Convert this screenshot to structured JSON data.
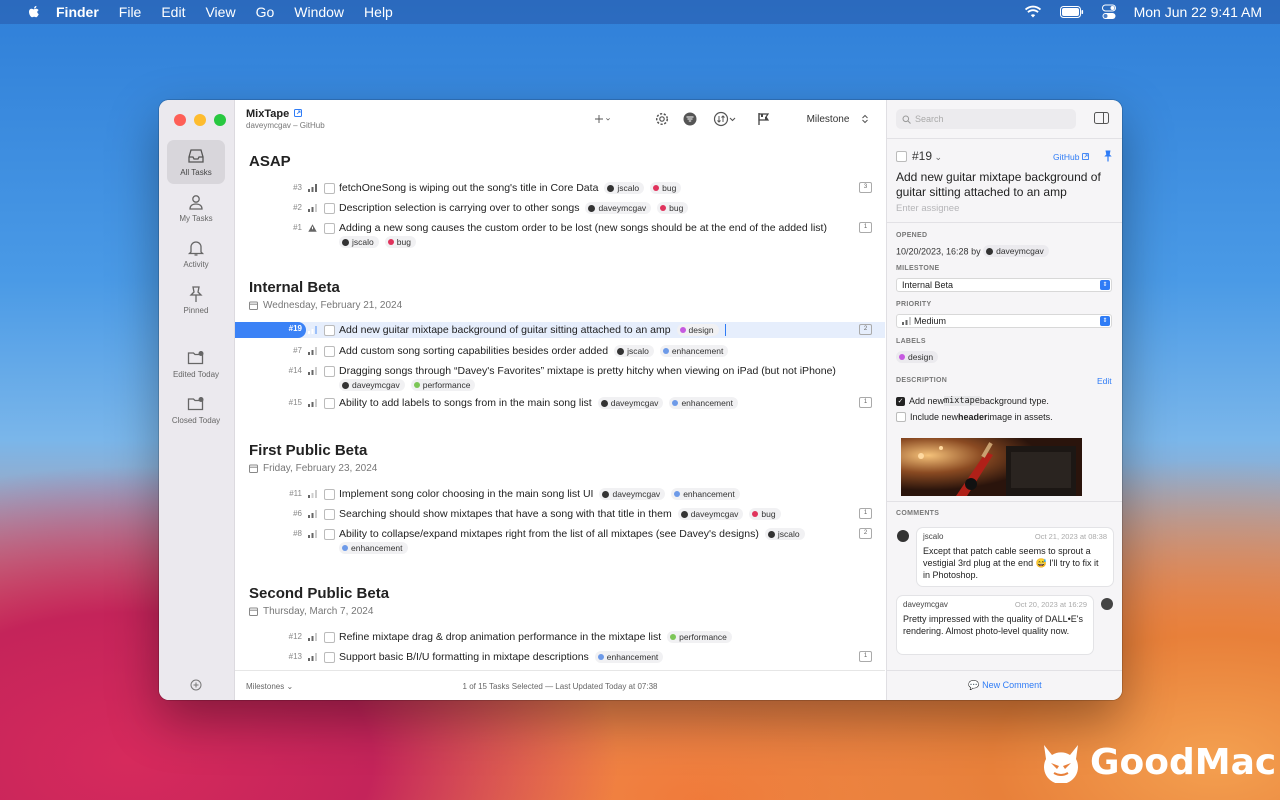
{
  "menubar": {
    "app": "Finder",
    "items": [
      "File",
      "Edit",
      "View",
      "Go",
      "Window",
      "Help"
    ],
    "clock": "Mon Jun 22  9:41 AM"
  },
  "sidebar": {
    "items": [
      {
        "label": "All Tasks",
        "icon": "tray-icon"
      },
      {
        "label": "My Tasks",
        "icon": "person-icon"
      },
      {
        "label": "Activity",
        "icon": "bell-icon"
      },
      {
        "label": "Pinned",
        "icon": "pin-icon"
      },
      {
        "label": "Edited Today",
        "icon": "folder-badge-icon"
      },
      {
        "label": "Closed Today",
        "icon": "folder-badge-icon"
      }
    ]
  },
  "toolbar": {
    "title": "MixTape",
    "subtitle": "daveymcgav – GitHub",
    "milestone_label": "Milestone"
  },
  "sections": [
    {
      "title": "ASAP",
      "date": ""
    },
    {
      "title": "Internal Beta",
      "date": "Wednesday, February 21, 2024"
    },
    {
      "title": "First Public Beta",
      "date": "Friday, February 23, 2024"
    },
    {
      "title": "Second Public Beta",
      "date": "Thursday, March 7, 2024"
    }
  ],
  "tasks": [
    {
      "num": "#3",
      "text": "fetchOneSong is wiping out the song's title in Core Data",
      "user": "jscalo",
      "tag": "bug",
      "comments": "3"
    },
    {
      "num": "#2",
      "text": "Description selection is carrying over to other songs",
      "user": "daveymcgav",
      "tag": "bug",
      "comments": ""
    },
    {
      "num": "#1",
      "text": "Adding a new song causes the custom order to be lost (new songs should be at the end of the added list)",
      "user": "jscalo",
      "tag": "bug",
      "comments": "1"
    },
    {
      "num": "#19",
      "text": "Add new guitar mixtape background of guitar sitting attached to an amp",
      "user": "",
      "tag": "design",
      "comments": "2"
    },
    {
      "num": "#7",
      "text": "Add custom song sorting capabilities besides order added",
      "user": "jscalo",
      "tag": "enhancement",
      "comments": ""
    },
    {
      "num": "#14",
      "text": "Dragging songs through “Davey's Favorites” mixtape is pretty hitchy when viewing on iPad (but not iPhone)",
      "user": "daveymcgav",
      "tag": "performance",
      "comments": ""
    },
    {
      "num": "#15",
      "text": "Ability to add labels to songs from in the main song list",
      "user": "daveymcgav",
      "tag": "enhancement",
      "comments": "1"
    },
    {
      "num": "#11",
      "text": "Implement song color choosing in the main song list UI",
      "user": "daveymcgav",
      "tag": "enhancement",
      "comments": ""
    },
    {
      "num": "#6",
      "text": "Searching should show mixtapes that have a song with that title in them",
      "user": "daveymcgav",
      "tag": "bug",
      "comments": "1"
    },
    {
      "num": "#8",
      "text": "Ability to collapse/expand mixtapes right from the list of all mixtapes (see Davey's designs)",
      "user": "jscalo",
      "tag": "enhancement",
      "comments": "2"
    },
    {
      "num": "#12",
      "text": "Refine mixtape drag & drop animation performance in the mixtape list",
      "user": "",
      "tag": "performance",
      "comments": ""
    },
    {
      "num": "#13",
      "text": "Support basic B/I/U formatting in mixtape descriptions",
      "user": "",
      "tag": "enhancement",
      "comments": "1"
    }
  ],
  "tag_colors": {
    "bug": "#e0335c",
    "design": "#c65ae0",
    "enhancement": "#6d9ae8",
    "performance": "#7cc657"
  },
  "footer": {
    "milestones": "Milestones",
    "status": "1 of 15 Tasks Selected — Last Updated Today at 07:38"
  },
  "inspector": {
    "search_placeholder": "Search",
    "number": "#19",
    "github": "GitHub",
    "title": "Add new guitar mixtape background of guitar sitting attached to an amp",
    "assignee_placeholder": "Enter assignee",
    "opened_label": "OPENED",
    "opened_value": "10/20/2023, 16:28 by",
    "opened_user": "daveymcgav",
    "milestone_label": "MILESTONE",
    "milestone_value": "Internal Beta",
    "priority_label": "PRIORITY",
    "priority_value": "Medium",
    "labels_label": "LABELS",
    "label_value": "design",
    "description_label": "DESCRIPTION",
    "edit": "Edit",
    "check1_a": "Add new ",
    "check1_code": "mixtape",
    "check1_b": " background type.",
    "check2_a": "Include new ",
    "check2_bold": "header",
    "check2_b": " image in assets.",
    "comments_label": "COMMENTS",
    "comments": [
      {
        "user": "jscalo",
        "time": "Oct 21, 2023 at 08:38",
        "body": "Except that patch cable seems to sprout a vestigial 3rd plug at the end 😅 I'll try to fix it in Photoshop."
      },
      {
        "user": "daveymcgav",
        "time": "Oct 20, 2023 at 16:29",
        "body": "Pretty impressed with the quality of DALL•E's rendering. Almost photo-level quality now."
      }
    ],
    "new_comment": "New Comment"
  },
  "watermark": "GoodMac"
}
